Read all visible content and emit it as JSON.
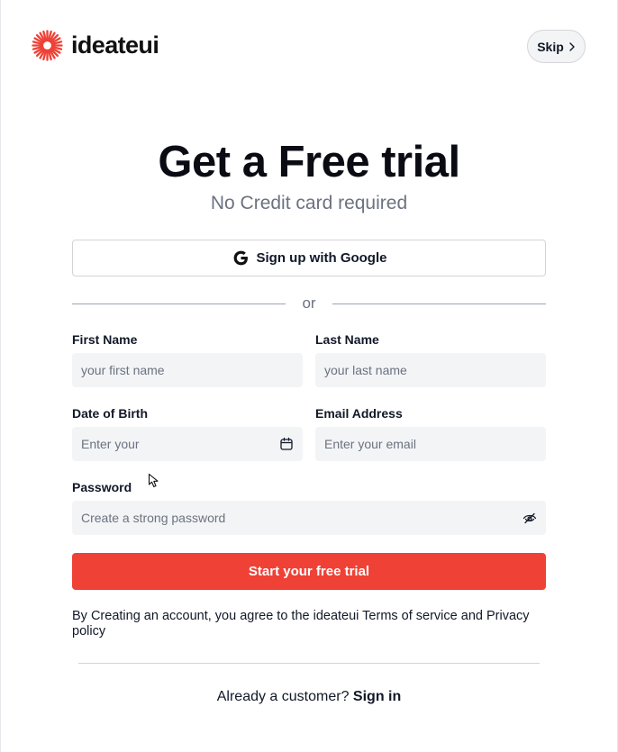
{
  "brand": {
    "name": "ideateui",
    "accent_color": "#ef4136"
  },
  "header": {
    "skip_label": "Skip",
    "skip_icon": "chevron-right-icon"
  },
  "hero": {
    "title": "Get a Free trial",
    "subtitle": "No Credit card required"
  },
  "google_button": {
    "label": "Sign up with Google",
    "icon": "google-icon"
  },
  "divider": {
    "label": "or"
  },
  "form": {
    "first_name": {
      "label": "First Name",
      "placeholder": "your first name",
      "value": ""
    },
    "last_name": {
      "label": "Last Name",
      "placeholder": "your last name",
      "value": ""
    },
    "dob": {
      "label": "Date of Birth",
      "placeholder": "Enter your",
      "value": "",
      "icon": "calendar-icon"
    },
    "email": {
      "label": "Email Address",
      "placeholder": "Enter your email",
      "value": ""
    },
    "password": {
      "label": "Password",
      "placeholder": "Create a strong password",
      "value": "",
      "icon": "eye-off-icon"
    }
  },
  "cta": {
    "label": "Start your free trial",
    "color": "#ef4136"
  },
  "terms": {
    "text": "By Creating an account, you agree to the ideateui Terms of service and Privacy policy"
  },
  "footer": {
    "prompt": "Already a customer?",
    "link_label": "Sign in"
  }
}
